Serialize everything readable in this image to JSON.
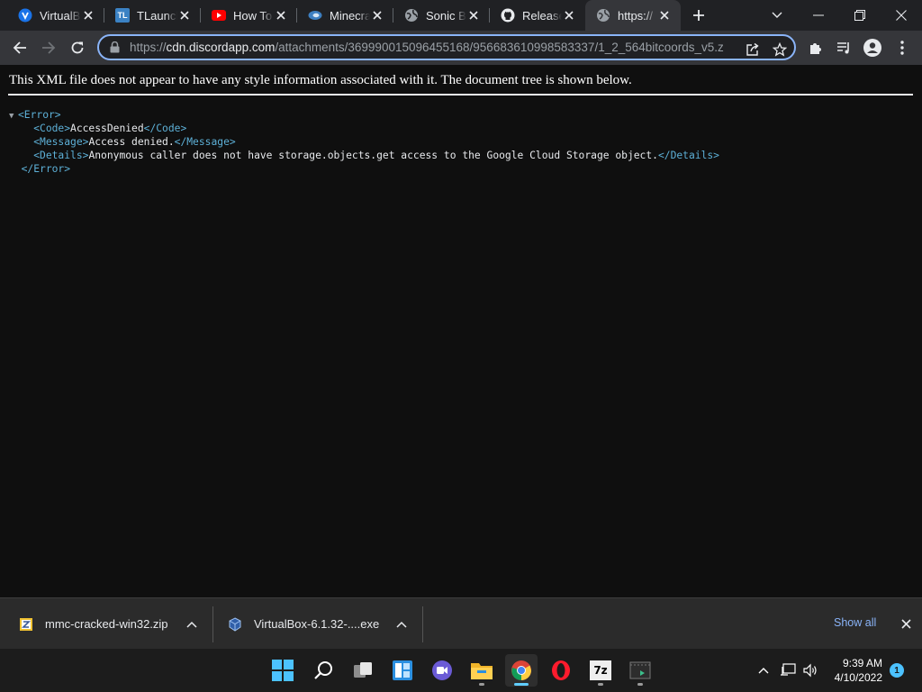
{
  "browser": {
    "tabs": [
      {
        "title": "VirtualB",
        "icon": "virtualbox-icon",
        "active": false
      },
      {
        "title": "TLaunch",
        "icon": "tlauncher-icon",
        "active": false
      },
      {
        "title": "How To",
        "icon": "youtube-icon",
        "active": false
      },
      {
        "title": "Minecra",
        "icon": "site-icon",
        "active": false
      },
      {
        "title": "Sonic B",
        "icon": "globe-icon",
        "active": false
      },
      {
        "title": "Release",
        "icon": "github-icon",
        "active": false
      },
      {
        "title": "https://",
        "icon": "globe-icon",
        "active": true
      }
    ],
    "tl_badge": "TL",
    "address": {
      "scheme": "https://",
      "host": "cdn.discordapp.com",
      "path": "/attachments/369990015096455168/956683610998583337/1_2_564bitcoords_v5.z"
    }
  },
  "page": {
    "notice": "This XML file does not appear to have any style information associated with it. The document tree is shown below.",
    "xml": {
      "root_open": "<Error>",
      "root_close": "</Error>",
      "code_open": "<Code>",
      "code_value": "AccessDenied",
      "code_close": "</Code>",
      "message_open": "<Message>",
      "message_value": "Access denied.",
      "message_close": "</Message>",
      "details_open": "<Details>",
      "details_value": "Anonymous caller does not have storage.objects.get access to the Google Cloud Storage object.",
      "details_close": "</Details>"
    }
  },
  "downloads": {
    "items": [
      {
        "filename": "mmc-cracked-win32.zip",
        "icon": "zip-file-icon"
      },
      {
        "filename": "VirtualBox-6.1.32-....exe",
        "icon": "installer-file-icon"
      }
    ],
    "show_all": "Show all"
  },
  "taskbar": {
    "apps": [
      "start-icon",
      "search-icon",
      "task-view-icon",
      "widgets-icon",
      "chat-icon",
      "file-explorer-icon",
      "chrome-icon",
      "opera-icon",
      "7zip-icon",
      "terminal-icon"
    ],
    "sevenzip_label": "7z",
    "time": "9:39 AM",
    "date": "4/10/2022",
    "notifications": "1"
  },
  "colors": {
    "accent": "#8ab4f8",
    "xml_tag": "#5db0d7",
    "taskbar_active": "#60cdff"
  }
}
